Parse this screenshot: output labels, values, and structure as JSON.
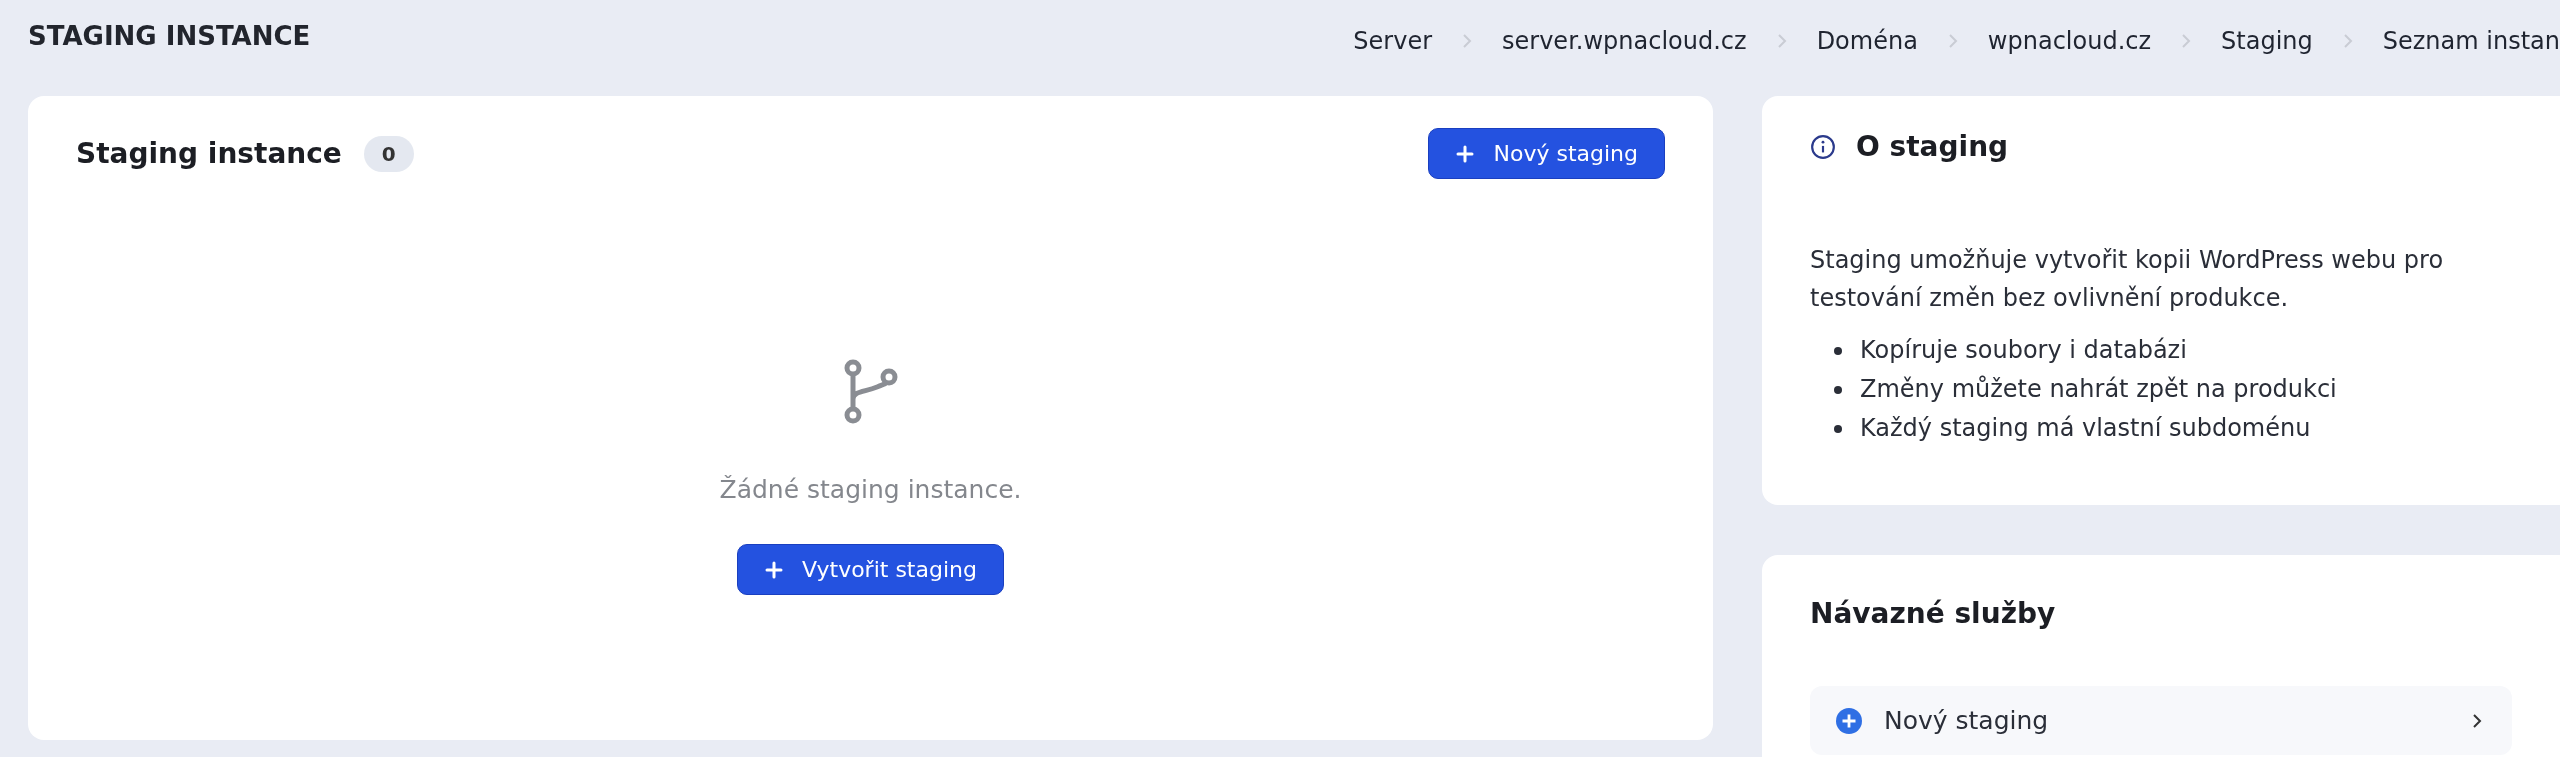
{
  "page_title": "STAGING INSTANCE",
  "breadcrumbs": [
    "Server",
    "server.wpnacloud.cz",
    "Doména",
    "wpnacloud.cz",
    "Staging",
    "Seznam instan"
  ],
  "instances_card": {
    "title": "Staging instance",
    "count": "0",
    "new_button": "Nový staging",
    "empty_message": "Žádné staging instance.",
    "create_button": "Vytvořit staging"
  },
  "about_card": {
    "title": "O staging",
    "description": "Staging umožňuje vytvořit kopii WordPress webu pro testování změn bez ovlivnění produkce.",
    "points": [
      "Kopíruje soubory i databázi",
      "Změny můžete nahrát zpět na produkci",
      "Každý staging má vlastní subdoménu"
    ]
  },
  "related_card": {
    "title": "Návazné služby",
    "items": [
      "Nový staging"
    ]
  }
}
